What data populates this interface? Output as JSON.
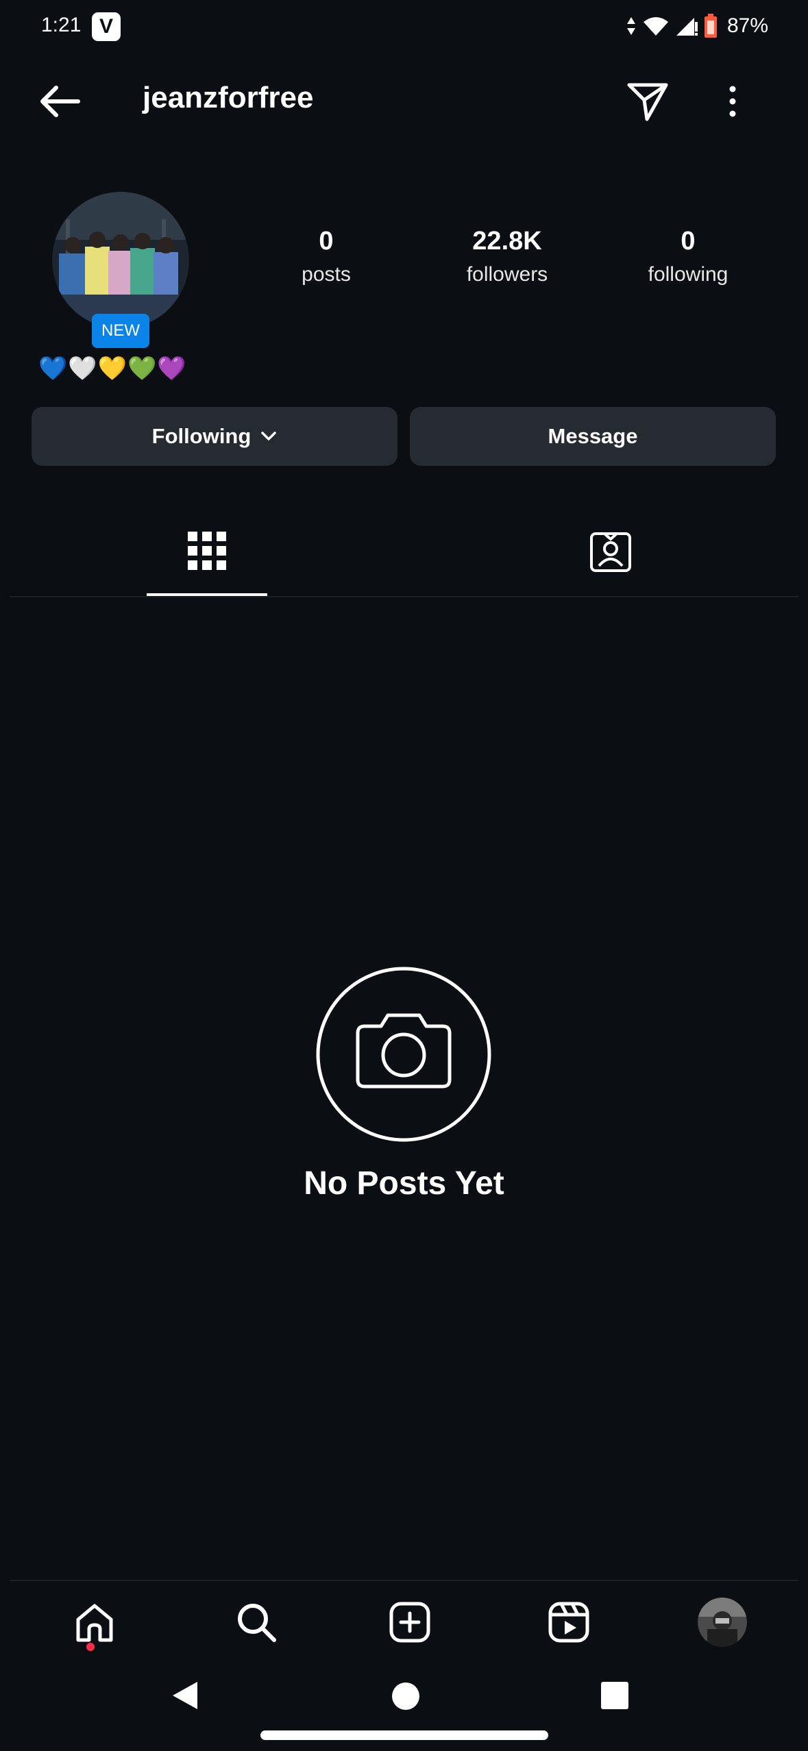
{
  "status_bar": {
    "time": "1:21",
    "app_badge": "V",
    "battery": "87%"
  },
  "header": {
    "username": "jeanzforfree"
  },
  "profile": {
    "new_badge": "NEW",
    "bio": "💙🤍💛💚💜",
    "stats": [
      {
        "value": "0",
        "label": "posts"
      },
      {
        "value": "22.8K",
        "label": "followers"
      },
      {
        "value": "0",
        "label": "following"
      }
    ]
  },
  "actions": {
    "following_label": "Following",
    "message_label": "Message"
  },
  "tabs": {
    "active": "grid",
    "items": [
      "grid-icon",
      "tagged-icon"
    ]
  },
  "empty_state": {
    "title": "No Posts Yet",
    "icon": "camera-icon"
  },
  "bottom_nav": {
    "items": [
      "home-icon",
      "search-icon",
      "create-icon",
      "reels-icon",
      "profile-avatar"
    ],
    "notification_color": "#ff2d4a"
  },
  "colors": {
    "background": "#0b0e13",
    "button": "#262a31",
    "accent": "#0a84e8"
  }
}
